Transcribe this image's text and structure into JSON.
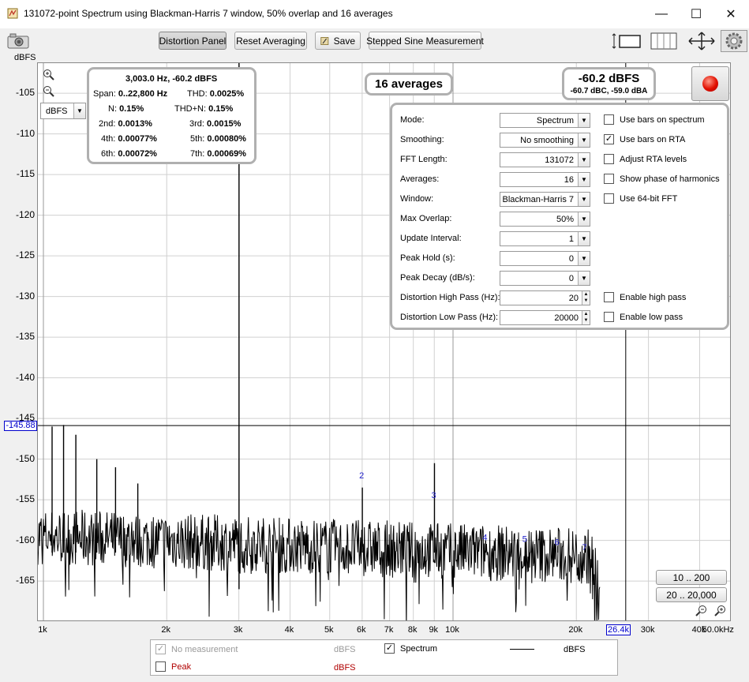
{
  "window": {
    "title": "131072-point Spectrum using Blackman-Harris 7 window, 50% overlap and 16 averages",
    "minimize": "—",
    "maximize": "☐",
    "close": "✕"
  },
  "toolbar": {
    "distortion_panel": "Distortion Panel",
    "reset_averaging": "Reset Averaging",
    "save": "Save",
    "stepped_sine": "Stepped Sine Measurement"
  },
  "unit_label": "dBFS",
  "unit_select": "dBFS",
  "distortion": {
    "header": "3,003.0 Hz, -60.2 dBFS",
    "span_label": "Span:",
    "span_value": "0..22,800 Hz",
    "thd_label": "THD:",
    "thd_value": "0.0025%",
    "n_label": "N:",
    "n_value": "0.15%",
    "thdn_label": "THD+N:",
    "thdn_value": "0.15%",
    "h2_label": "2nd:",
    "h2_value": "0.0013%",
    "h3_label": "3rd:",
    "h3_value": "0.0015%",
    "h4_label": "4th:",
    "h4_value": "0.00077%",
    "h5_label": "5th:",
    "h5_value": "0.00080%",
    "h6_label": "6th:",
    "h6_value": "0.00072%",
    "h7_label": "7th:",
    "h7_value": "0.00069%"
  },
  "averages_badge": "16 averages",
  "level": {
    "main": "-60.2 dBFS",
    "sub": "-60.7 dBC, -59.0 dBA"
  },
  "settings": {
    "mode_label": "Mode:",
    "mode_value": "Spectrum",
    "smoothing_label": "Smoothing:",
    "smoothing_value": "No  smoothing",
    "fft_label": "FFT Length:",
    "fft_value": "131072",
    "averages_label": "Averages:",
    "averages_value": "16",
    "window_label": "Window:",
    "window_value": "Blackman-Harris 7",
    "overlap_label": "Max Overlap:",
    "overlap_value": "50%",
    "update_label": "Update Interval:",
    "update_value": "1",
    "peakhold_label": "Peak Hold (s):",
    "peakhold_value": "0",
    "peakdecay_label": "Peak Decay (dB/s):",
    "peakdecay_value": "0",
    "hp_label": "Distortion High Pass (Hz):",
    "hp_value": "20",
    "lp_label": "Distortion Low Pass (Hz):",
    "lp_value": "20000",
    "chk_bars_spectrum": "Use bars on spectrum",
    "chk_bars_rta": "Use bars on RTA",
    "chk_adjust_rta": "Adjust RTA levels",
    "chk_phase": "Show phase of harmonics",
    "chk_64bit": "Use 64-bit FFT",
    "chk_high_pass": "Enable high pass",
    "chk_low_pass": "Enable low pass",
    "checked_mark": "✓"
  },
  "plot": {
    "y_ticks": [
      "-105",
      "-110",
      "-115",
      "-120",
      "-125",
      "-130",
      "-135",
      "-140",
      "-145",
      "-150",
      "-155",
      "-160",
      "-165"
    ],
    "x_ticks": [
      "1k",
      "2k",
      "3k",
      "4k",
      "5k",
      "6k",
      "7k",
      "8k",
      "9k",
      "10k",
      "20k",
      "30k",
      "40k",
      "50.0kHz"
    ],
    "cursor_level": "-145.88",
    "cursor_freq": "26.4k",
    "harmonic_markers": [
      "2",
      "3",
      "4",
      "5",
      "6",
      "7"
    ]
  },
  "range_buttons": {
    "r1": "10 .. 200",
    "r2": "20 .. 20,000"
  },
  "legend": {
    "no_measurement": "No measurement",
    "no_measurement_unit": "dBFS",
    "spectrum": "Spectrum",
    "spectrum_unit": "dBFS",
    "peak": "Peak",
    "peak_unit": "dBFS",
    "spectrum_mark": "✓"
  }
}
